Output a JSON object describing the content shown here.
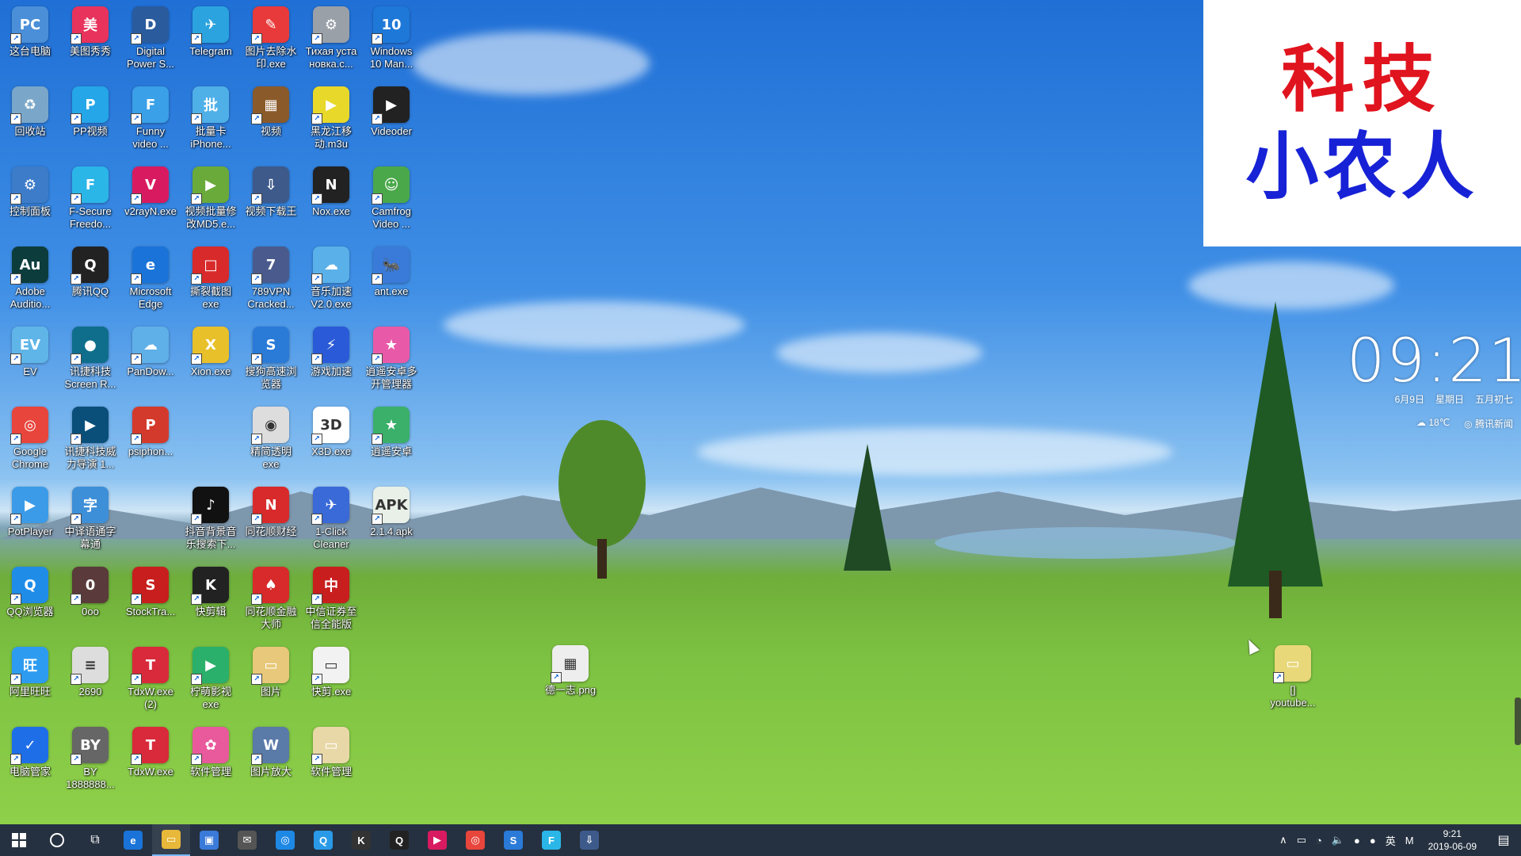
{
  "desktop": {
    "icons": [
      {
        "label": "这台电脑",
        "color": "#4a8fd8",
        "glyph": "PC"
      },
      {
        "label": "回收站",
        "color": "#7aa7c9",
        "glyph": "♻"
      },
      {
        "label": "控制面板",
        "color": "#3d7cc9",
        "glyph": "⚙"
      },
      {
        "label": "Adobe\nAuditio...",
        "color": "#0d3c3c",
        "glyph": "Au"
      },
      {
        "label": "EV",
        "color": "#5fb5e8",
        "glyph": "EV"
      },
      {
        "label": "Google\nChrome",
        "color": "#e8453c",
        "glyph": "◎"
      },
      {
        "label": "PotPlayer",
        "color": "#3b9be8",
        "glyph": "▶"
      },
      {
        "label": "QQ浏览器",
        "color": "#1f8ce8",
        "glyph": "Q"
      },
      {
        "label": "阿里旺旺",
        "color": "#2d9cf0",
        "glyph": "旺"
      },
      {
        "label": "电脑管家",
        "color": "#1e6ee8",
        "glyph": "✓"
      },
      {
        "label": "美图秀秀",
        "color": "#e8335c",
        "glyph": "美"
      },
      {
        "label": "PP视频",
        "color": "#24a6e8",
        "glyph": "P"
      },
      {
        "label": "F-Secure\nFreedo...",
        "color": "#2bb6e8",
        "glyph": "F"
      },
      {
        "label": "腾讯QQ",
        "color": "#222222",
        "glyph": "Q"
      },
      {
        "label": "讯捷科技\nScreen R...",
        "color": "#0f6e8c",
        "glyph": "●"
      },
      {
        "label": "讯捷科技威\n力导演 1...",
        "color": "#0a4f7a",
        "glyph": "▶"
      },
      {
        "label": "中译语通字\n幕通",
        "color": "#3d8fd8",
        "glyph": "字"
      },
      {
        "label": "0oo",
        "color": "#5a3a3a",
        "glyph": "0"
      },
      {
        "label": "2690",
        "color": "#dddddd",
        "glyph": "≡"
      },
      {
        "label": "BY\n1888888...",
        "color": "#666666",
        "glyph": "BY"
      },
      {
        "label": "Digital\nPower S...",
        "color": "#2a5b9c",
        "glyph": "D"
      },
      {
        "label": "Funny\nvideo ...",
        "color": "#3aa0e8",
        "glyph": "F"
      },
      {
        "label": "v2rayN.exe",
        "color": "#d81b60",
        "glyph": "V"
      },
      {
        "label": "Microsoft\nEdge",
        "color": "#1a73d8",
        "glyph": "e"
      },
      {
        "label": "PanDow...",
        "color": "#5fb0e8",
        "glyph": "☁"
      },
      {
        "label": "psiphon...",
        "color": "#d33a2c",
        "glyph": "P"
      },
      {
        "label": "StockTra...",
        "color": "#c81e1e",
        "glyph": "S"
      },
      {
        "label": "TdxW.exe\n(2)",
        "color": "#d82a3a",
        "glyph": "T"
      },
      {
        "label": "TdxW.exe",
        "color": "#d82a3a",
        "glyph": "T"
      },
      {
        "label": "Telegram",
        "color": "#2aa3df",
        "glyph": "✈"
      },
      {
        "label": "批量卡\niPhone...",
        "color": "#4fb0e8",
        "glyph": "批"
      },
      {
        "label": "视频批量修\n改MD5.e...",
        "color": "#6aaa3a",
        "glyph": "▶"
      },
      {
        "label": "撕裂截图\nexe",
        "color": "#d82a2a",
        "glyph": "□"
      },
      {
        "label": "Xion.exe",
        "color": "#e8c02a",
        "glyph": "X"
      },
      {
        "label": "抖音背景音\n乐搜索下...",
        "color": "#111111",
        "glyph": "♪"
      },
      {
        "label": "快剪辑",
        "color": "#222222",
        "glyph": "K"
      },
      {
        "label": "柠萌影视\nexe",
        "color": "#2ab06a",
        "glyph": "▶"
      },
      {
        "label": "软件管理",
        "color": "#e85a9c",
        "glyph": "✿"
      },
      {
        "label": "图片去除水\n印.exe",
        "color": "#e83a3a",
        "glyph": "✎"
      },
      {
        "label": "视频",
        "color": "#8a5a2a",
        "glyph": "▦"
      },
      {
        "label": "视频下载王",
        "color": "#3d5a8a",
        "glyph": "⇩"
      },
      {
        "label": "789VPN\nCracked...",
        "color": "#4a5a8c",
        "glyph": "7"
      },
      {
        "label": "搜狗高速浏\n览器",
        "color": "#2a7ad8",
        "glyph": "S"
      },
      {
        "label": "精简透明\nexe",
        "color": "#dddddd",
        "glyph": "◉"
      },
      {
        "label": "同花顺财经",
        "color": "#d82a2a",
        "glyph": "N"
      },
      {
        "label": "同花顺金融\n大师",
        "color": "#d82a2a",
        "glyph": "♠"
      },
      {
        "label": "图片",
        "color": "#e8c87a",
        "glyph": "▭"
      },
      {
        "label": "图片放大",
        "color": "#5a7aa8",
        "glyph": "W"
      },
      {
        "label": "Тихая уста\nновка.с...",
        "color": "#9aa0a8",
        "glyph": "⚙"
      },
      {
        "label": "黑龙江移\n动.m3u",
        "color": "#e8d82a",
        "glyph": "▶"
      },
      {
        "label": "Nox.exe",
        "color": "#222222",
        "glyph": "N"
      },
      {
        "label": "音乐加速\nV2.0.exe",
        "color": "#5ab0e8",
        "glyph": "☁"
      },
      {
        "label": "游戏加速",
        "color": "#2a5ad8",
        "glyph": "⚡"
      },
      {
        "label": "X3D.exe",
        "color": "#ffffff",
        "glyph": "3D"
      },
      {
        "label": "1-Click\nCleaner",
        "color": "#3a6ad8",
        "glyph": "✈"
      },
      {
        "label": "中信证券至\n信全能版",
        "color": "#c81e1e",
        "glyph": "中"
      },
      {
        "label": "快剪.exe",
        "color": "#f2f2f2",
        "glyph": "▭"
      },
      {
        "label": "软件管理",
        "color": "#e8d8a8",
        "glyph": "▭"
      },
      {
        "label": "Windows\n10 Man...",
        "color": "#1e78d8",
        "glyph": "10"
      },
      {
        "label": "Videoder",
        "color": "#222222",
        "glyph": "▶"
      },
      {
        "label": "Camfrog\nVideo ...",
        "color": "#4aa84a",
        "glyph": "☺"
      },
      {
        "label": "ant.exe",
        "color": "#3a7ad8",
        "glyph": "🐜"
      },
      {
        "label": "逍遥安卓多\n开管理器",
        "color": "#e85aa8",
        "glyph": "★"
      },
      {
        "label": "逍遥安卓",
        "color": "#3ab06a",
        "glyph": "★"
      },
      {
        "label": "2.1.4.apk",
        "color": "#e8f0e8",
        "glyph": "APK"
      }
    ],
    "extra_icons": [
      {
        "label": "德一志.png",
        "color": "#eeeeee",
        "glyph": "▦"
      },
      {
        "label": "[]\nyoutube...",
        "color": "#e8d87a",
        "glyph": "▭"
      }
    ]
  },
  "watermark": {
    "line1": "科技",
    "line2": "小农人"
  },
  "clock_widget": {
    "time": "09:21",
    "date": "6月9日",
    "weekday": "星期日",
    "lunar": "五月初七",
    "weather": "18℃",
    "news": "腾讯新闻"
  },
  "taskbar": {
    "apps": [
      {
        "name": "edge",
        "glyph": "e",
        "color": "#1a73d8"
      },
      {
        "name": "file-explorer",
        "glyph": "▭",
        "color": "#e8b83a"
      },
      {
        "name": "store",
        "glyph": "▣",
        "color": "#3a7ad8"
      },
      {
        "name": "mail",
        "glyph": "✉",
        "color": "#555555"
      },
      {
        "name": "browser",
        "glyph": "◎",
        "color": "#1e88e5"
      },
      {
        "name": "qq-browser",
        "glyph": "Q",
        "color": "#2a9ae8"
      },
      {
        "name": "kuaijianji",
        "glyph": "K",
        "color": "#333333"
      },
      {
        "name": "qq",
        "glyph": "Q",
        "color": "#222222"
      },
      {
        "name": "pointer-app",
        "glyph": "▶",
        "color": "#d81b60"
      },
      {
        "name": "chrome",
        "glyph": "◎",
        "color": "#e8453c"
      },
      {
        "name": "sogou",
        "glyph": "S",
        "color": "#2a7ad8"
      },
      {
        "name": "f-secure",
        "glyph": "F",
        "color": "#2bb6e8"
      },
      {
        "name": "video-download",
        "glyph": "⇩",
        "color": "#3d5a8a"
      }
    ],
    "tray": {
      "ime": "英",
      "ime2": "M",
      "time": "9:21",
      "date": "2019-06-09"
    }
  }
}
